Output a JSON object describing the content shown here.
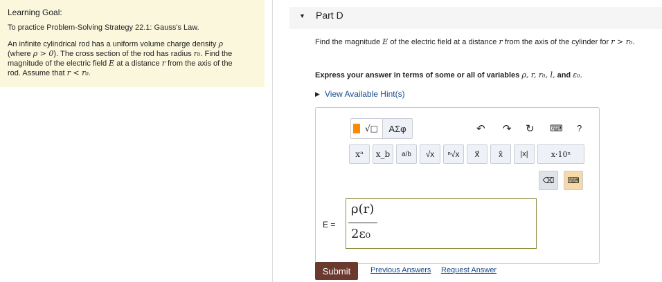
{
  "learning_goal": {
    "title": "Learning Goal:",
    "line1": "To practice Problem-Solving Strategy 22.1: Gauss's Law.",
    "line2a": "An infinite cylindrical rod has a uniform volume charge density",
    "line2b_pre": "(where",
    "line2b_mid": "). The cross section of the rod has radius",
    "line2b_end": ". Find the",
    "line2c_pre": "magnitude of the electric field",
    "line2c_mid": "at a distance",
    "line2c_end": "from the axis of the",
    "line2d_pre": "rod. Assume that",
    "sym_rho": "ρ",
    "sym_rho_gt0": "ρ > 0",
    "sym_r0": "r₀",
    "sym_E": "E",
    "sym_r": "r",
    "sym_r_lt_r0": "r < r₀"
  },
  "part": {
    "title": "Part D"
  },
  "question": {
    "pre": "Find the magnitude",
    "sym_E": "E",
    "mid": "of the electric field at a distance",
    "sym_r": "r",
    "post": "from the axis of the cylinder for",
    "cond": "r > r₀."
  },
  "express": {
    "text": "Express your answer in terms of some or all of variables",
    "vars": "ρ, r, r₀, l,",
    "and": "and",
    "eps": "ε₀."
  },
  "hint": {
    "label": "View Available Hint(s)"
  },
  "editor": {
    "tab_templates": "√□",
    "tab_greek": "ΑΣφ",
    "buttons": [
      "xᵃ",
      "x_b",
      "a/b",
      "√x",
      "ⁿ√x",
      "x⃗",
      "x̂",
      "|x|",
      "x·10ⁿ"
    ],
    "undo": "↶",
    "redo": "↷",
    "reset": "↻",
    "keyboard": "⌨",
    "help": "?",
    "delete": "⌫",
    "keyboard2": "⌨",
    "answer_label": "E =",
    "answer_num": "ρ(r)",
    "answer_den": "2ε₀"
  },
  "actions": {
    "submit": "Submit",
    "previous": "Previous Answers",
    "request": "Request Answer"
  }
}
